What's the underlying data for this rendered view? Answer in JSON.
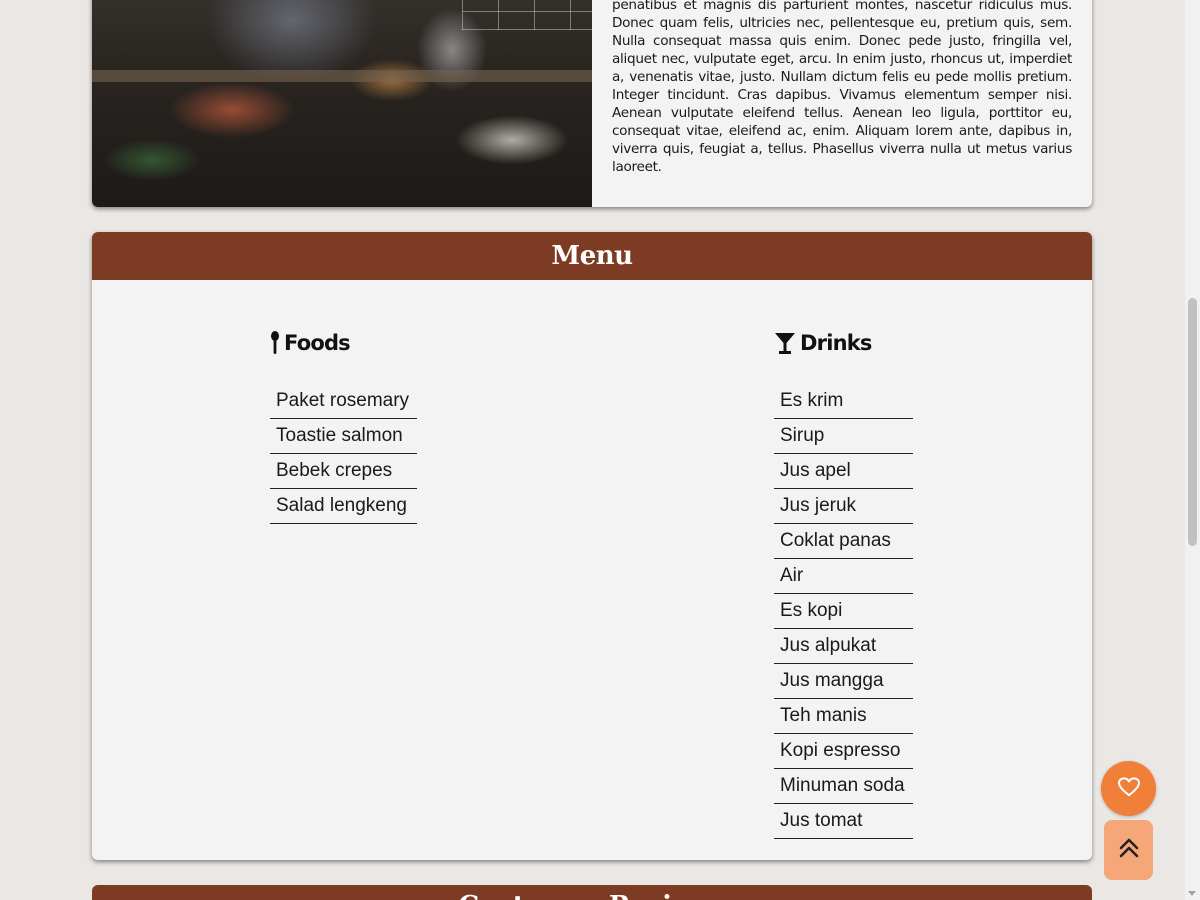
{
  "about": {
    "paragraph": "penatibus et magnis dis parturient montes, nascetur ridiculus mus. Donec quam felis, ultricies nec, pellentesque eu, pretium quis, sem. Nulla consequat massa quis enim. Donec pede justo, fringilla vel, aliquet nec, vulputate eget, arcu. In enim justo, rhoncus ut, imperdiet a, venenatis vitae, justo. Nullam dictum felis eu pede mollis pretium. Integer tincidunt. Cras dapibus. Vivamus elementum semper nisi. Aenean vulputate eleifend tellus. Aenean leo ligula, porttitor eu, consequat vitae, eleifend ac, enim. Aliquam lorem ante, dapibus in, viverra quis, feugiat a, tellus. Phasellus viverra nulla ut metus varius laoreet."
  },
  "menu": {
    "title": "Menu",
    "foods": {
      "heading": "Foods",
      "icon": "spoon-icon",
      "items": [
        "Paket rosemary",
        "Toastie salmon",
        "Bebek crepes",
        "Salad lengkeng"
      ]
    },
    "drinks": {
      "heading": "Drinks",
      "icon": "cocktail-glass-icon",
      "items": [
        "Es krim",
        "Sirup",
        "Jus apel",
        "Jus jeruk",
        "Coklat panas",
        "Air",
        "Es kopi",
        "Jus alpukat",
        "Jus mangga",
        "Teh manis",
        "Kopi espresso",
        "Minuman soda",
        "Jus tomat"
      ]
    }
  },
  "next_section": {
    "title": "Customer Reviews"
  },
  "buttons": {
    "favorite_icon": "heart-icon",
    "back_to_top_icon": "double-chevron-up-icon"
  },
  "colors": {
    "header_brown": "#7c3b22",
    "fab_orange": "#f07f3a",
    "fab_light_orange": "#f5a77a",
    "card_bg": "#f3f3f3",
    "page_bg": "#ebe7e4"
  }
}
